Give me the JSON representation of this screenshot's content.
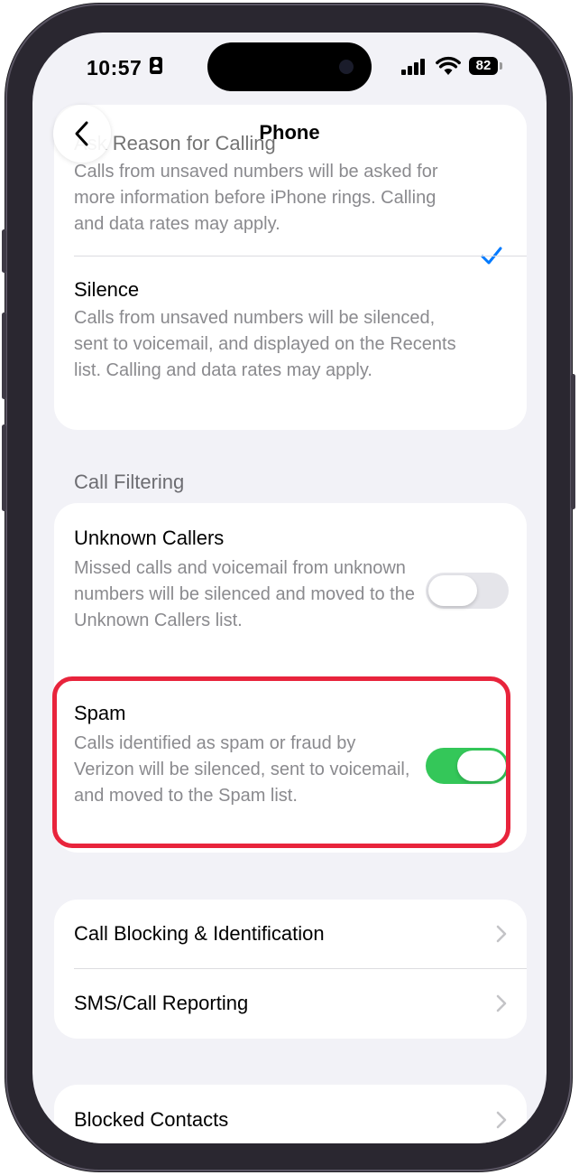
{
  "status_bar": {
    "time": "10:57",
    "battery": "82",
    "icons": [
      "id-card-icon",
      "signal-icon",
      "wifi-icon",
      "battery-icon"
    ]
  },
  "nav": {
    "title": "Phone",
    "back_icon": "chevron-left-icon"
  },
  "screening_options": {
    "faded_text": "hidden above",
    "ask_reason": {
      "title": "Ask Reason for Calling",
      "description": "Calls from unsaved numbers will be asked for more information before iPhone rings. Calling and data rates may apply.",
      "selected": true
    },
    "silence": {
      "title": "Silence",
      "description": "Calls from unsaved numbers will be silenced, sent to voicemail, and displayed on the Recents list. Calling and data rates may apply.",
      "selected": false
    }
  },
  "call_filtering": {
    "header": "Call Filtering",
    "unknown_callers": {
      "title": "Unknown Callers",
      "description": "Missed calls and voicemail from unknown numbers will be silenced and moved to the Unknown Callers list.",
      "enabled": false
    },
    "spam": {
      "title": "Spam",
      "description": "Calls identified as spam or fraud by Verizon will be silenced, sent to voicemail, and moved to the Spam list.",
      "enabled": true
    }
  },
  "links_group": {
    "items": [
      {
        "label": "Call Blocking & Identification"
      },
      {
        "label": "SMS/Call Reporting"
      }
    ]
  },
  "blocked_group": {
    "items": [
      {
        "label": "Blocked Contacts"
      }
    ]
  },
  "colors": {
    "accent": "#007aff",
    "toggle_on": "#34c759",
    "toggle_off": "#e5e5ea",
    "highlight": "#e8243c"
  }
}
